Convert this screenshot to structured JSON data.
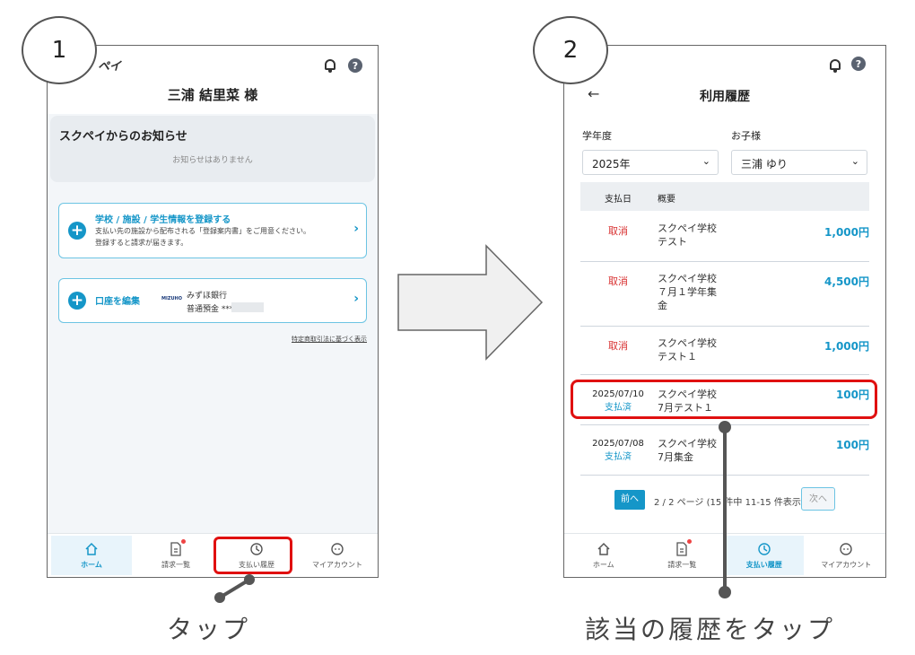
{
  "steps": [
    "1",
    "2"
  ],
  "captions": {
    "left": "タップ",
    "right": "該当の履歴をタップ"
  },
  "screen1": {
    "app_logo_partial": "ペイ",
    "user_name": "三浦 結里菜 様",
    "notice_title": "スクペイからのお知らせ",
    "notice_empty": "お知らせはありません",
    "register_card": {
      "title": "学校 / 施設 / 学生情報を登録する",
      "desc_line1": "支払い先の施設から配布される「登録案内書」をご用意ください。",
      "desc_line2": "登録すると請求が届きます。"
    },
    "account_card": {
      "title": "口座を編集",
      "bank_logo": "MIZUHO",
      "bank_name": "みずほ銀行",
      "account_type": "普通預金 ***"
    },
    "legal_link": "特定商取引法に基づく表示",
    "nav": [
      "ホーム",
      "請求一覧",
      "支払い履歴",
      "マイアカウント"
    ]
  },
  "screen2": {
    "title": "利用履歴",
    "year_label": "学年度",
    "year_value": "2025年",
    "child_label": "お子様",
    "child_value": "三浦 ゆり",
    "table_headers": [
      "支払日",
      "概要"
    ],
    "rows": [
      {
        "status": "取消",
        "date": "",
        "summary1": "スクペイ学校",
        "summary2": "テスト",
        "summary3": "",
        "amount": "1,000円"
      },
      {
        "status": "取消",
        "date": "",
        "summary1": "スクペイ学校",
        "summary2": "７月１学年集",
        "summary3": "金",
        "amount": "4,500円"
      },
      {
        "status": "取消",
        "date": "",
        "summary1": "スクペイ学校",
        "summary2": "テスト１",
        "summary3": "",
        "amount": "1,000円"
      },
      {
        "status": "支払済",
        "date": "2025/07/10",
        "summary1": "スクペイ学校",
        "summary2": "7月テスト１",
        "summary3": "",
        "amount": "100円"
      },
      {
        "status": "支払済",
        "date": "2025/07/08",
        "summary1": "スクペイ学校",
        "summary2": "7月集金",
        "summary3": "",
        "amount": "100円"
      }
    ],
    "pagination": {
      "prev": "前へ",
      "info": "2 / 2 ページ (15 件中 11-15 件表示)",
      "next": "次へ"
    },
    "nav": [
      "ホーム",
      "請求一覧",
      "支払い履歴",
      "マイアカウント"
    ]
  },
  "colors": {
    "accent": "#1596c8",
    "highlight": "#e01010",
    "cancel": "#d83030"
  }
}
